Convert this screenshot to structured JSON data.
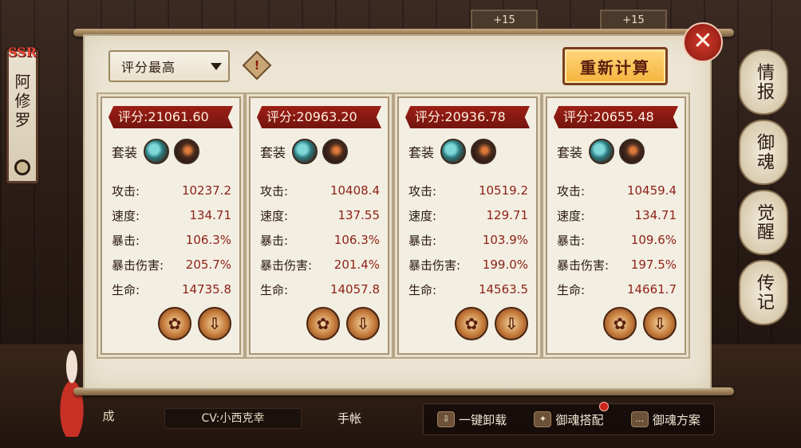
{
  "character": {
    "rarity": "SSR",
    "name": "阿修罗"
  },
  "top_tabs": [
    "+15",
    "+15"
  ],
  "side_tabs": [
    "情报",
    "御魂",
    "觉醒",
    "传记"
  ],
  "panel": {
    "sort_dropdown": {
      "selected": "评分最高"
    },
    "info_icon_glyph": "!",
    "recalc_button": "重新计算",
    "close_glyph": "✕"
  },
  "cards": [
    {
      "score": "评分:21061.60",
      "set_label": "套装",
      "stats": [
        {
          "label": "攻击:",
          "value": "10237.2"
        },
        {
          "label": "速度:",
          "value": "134.71"
        },
        {
          "label": "暴击:",
          "value": "106.3%"
        },
        {
          "label": "暴击伤害:",
          "value": "205.7%"
        },
        {
          "label": "生命:",
          "value": "14735.8"
        }
      ]
    },
    {
      "score": "评分:20963.20",
      "set_label": "套装",
      "stats": [
        {
          "label": "攻击:",
          "value": "10408.4"
        },
        {
          "label": "速度:",
          "value": "137.55"
        },
        {
          "label": "暴击:",
          "value": "106.3%"
        },
        {
          "label": "暴击伤害:",
          "value": "201.4%"
        },
        {
          "label": "生命:",
          "value": "14057.8"
        }
      ]
    },
    {
      "score": "评分:20936.78",
      "set_label": "套装",
      "stats": [
        {
          "label": "攻击:",
          "value": "10519.2"
        },
        {
          "label": "速度:",
          "value": "129.71"
        },
        {
          "label": "暴击:",
          "value": "103.9%"
        },
        {
          "label": "暴击伤害:",
          "value": "199.0%"
        },
        {
          "label": "生命:",
          "value": "14563.5"
        }
      ]
    },
    {
      "score": "评分:20655.48",
      "set_label": "套装",
      "stats": [
        {
          "label": "攻击:",
          "value": "10459.4"
        },
        {
          "label": "速度:",
          "value": "134.71"
        },
        {
          "label": "暴击:",
          "value": "109.6%"
        },
        {
          "label": "暴击伤害:",
          "value": "197.5%"
        },
        {
          "label": "生命:",
          "value": "14661.7"
        }
      ]
    }
  ],
  "bottom": {
    "cheng": "成",
    "cv": "CV:小西克幸",
    "handbook": "手帐",
    "actions": [
      "一键卸载",
      "御魂搭配",
      "御魂方案"
    ]
  },
  "colors": {
    "accent_red": "#9d1f16",
    "button_gold": "#f4b33c",
    "panel_paper": "#ece5d4"
  }
}
